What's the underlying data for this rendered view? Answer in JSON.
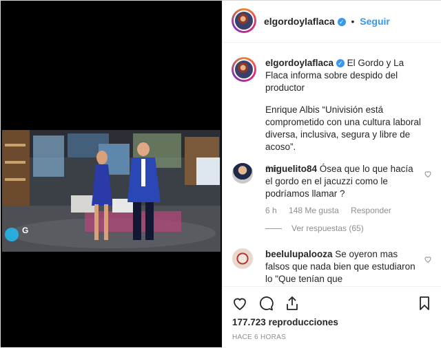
{
  "post": {
    "username": "elgordoylaflaca",
    "follow_label": "Seguir",
    "separator": "•",
    "caption_title": "El Gordo y La Flaca informa sobre despido del productor",
    "caption_body": "Enrique Albis “Univisión está comprometido con una cultura laboral diversa, inclusiva, segura y libre de acoso”.",
    "caption_time": "6 h",
    "views_count": "177.723",
    "views_label": "reproducciones",
    "posted_ago": "HACE 6 HORAS"
  },
  "video": {
    "watermark": "G"
  },
  "comments": [
    {
      "username": "miguelito84",
      "text": "Ósea que lo que hacía el gordo en el jacuzzi como le podríamos llamar ?",
      "time": "6 h",
      "likes": "148 Me gusta",
      "reply_label": "Responder",
      "replies_label": "Ver respuestas (65)"
    },
    {
      "username": "beelulupalooza",
      "text": "Se oyeron mas falsos que nada bien que estudiaron lo \"Que tenían que"
    }
  ],
  "icons": {
    "like": "heart-icon",
    "comment": "comment-icon",
    "share": "share-icon",
    "save": "bookmark-icon",
    "verified": "verified-badge-icon",
    "comment_like": "heart-outline-icon"
  },
  "colors": {
    "link_blue": "#3897f0",
    "meta_gray": "#8e8e8e",
    "text": "#262626"
  }
}
